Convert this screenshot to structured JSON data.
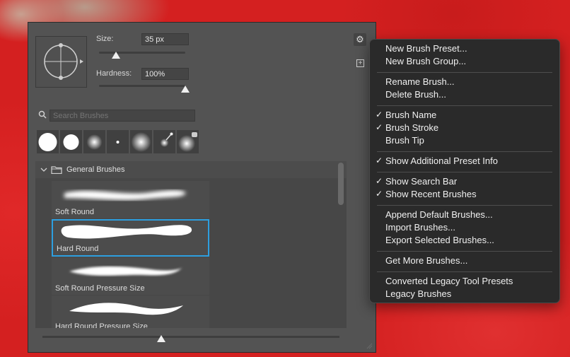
{
  "brush_panel": {
    "size_label": "Size:",
    "size_value": "35 px",
    "size_level": 0.2,
    "hardness_label": "Hardness:",
    "hardness_value": "100%",
    "hardness_level": 1.0,
    "search_placeholder": "Search Brushes",
    "recent_brushes": [
      "hard-round",
      "hard-round-small",
      "soft-round-small",
      "dot",
      "soft-round-large",
      "airbrush",
      "spatter"
    ],
    "group_name": "General Brushes",
    "brushes": [
      {
        "name": "Soft Round",
        "selected": false
      },
      {
        "name": "Hard Round",
        "selected": true
      },
      {
        "name": "Soft Round Pressure Size",
        "selected": false
      },
      {
        "name": "Hard Round Pressure Size",
        "selected": false
      }
    ],
    "preview_size_level": 0.4,
    "accent_color": "#2d9fe0"
  },
  "menu": {
    "groups": [
      [
        {
          "label": "New Brush Preset...",
          "checked": false
        },
        {
          "label": "New Brush Group...",
          "checked": false
        }
      ],
      [
        {
          "label": "Rename Brush...",
          "checked": false
        },
        {
          "label": "Delete Brush...",
          "checked": false
        }
      ],
      [
        {
          "label": "Brush Name",
          "checked": true
        },
        {
          "label": "Brush Stroke",
          "checked": true
        },
        {
          "label": "Brush Tip",
          "checked": false
        }
      ],
      [
        {
          "label": "Show Additional Preset Info",
          "checked": true
        }
      ],
      [
        {
          "label": "Show Search Bar",
          "checked": true
        },
        {
          "label": "Show Recent Brushes",
          "checked": true
        }
      ],
      [
        {
          "label": "Append Default Brushes...",
          "checked": false
        },
        {
          "label": "Import Brushes...",
          "checked": false
        },
        {
          "label": "Export Selected Brushes...",
          "checked": false
        }
      ],
      [
        {
          "label": "Get More Brushes...",
          "checked": false
        }
      ],
      [
        {
          "label": "Converted Legacy Tool Presets",
          "checked": false
        },
        {
          "label": "Legacy Brushes",
          "checked": false
        }
      ]
    ],
    "check_glyph": "✓"
  }
}
